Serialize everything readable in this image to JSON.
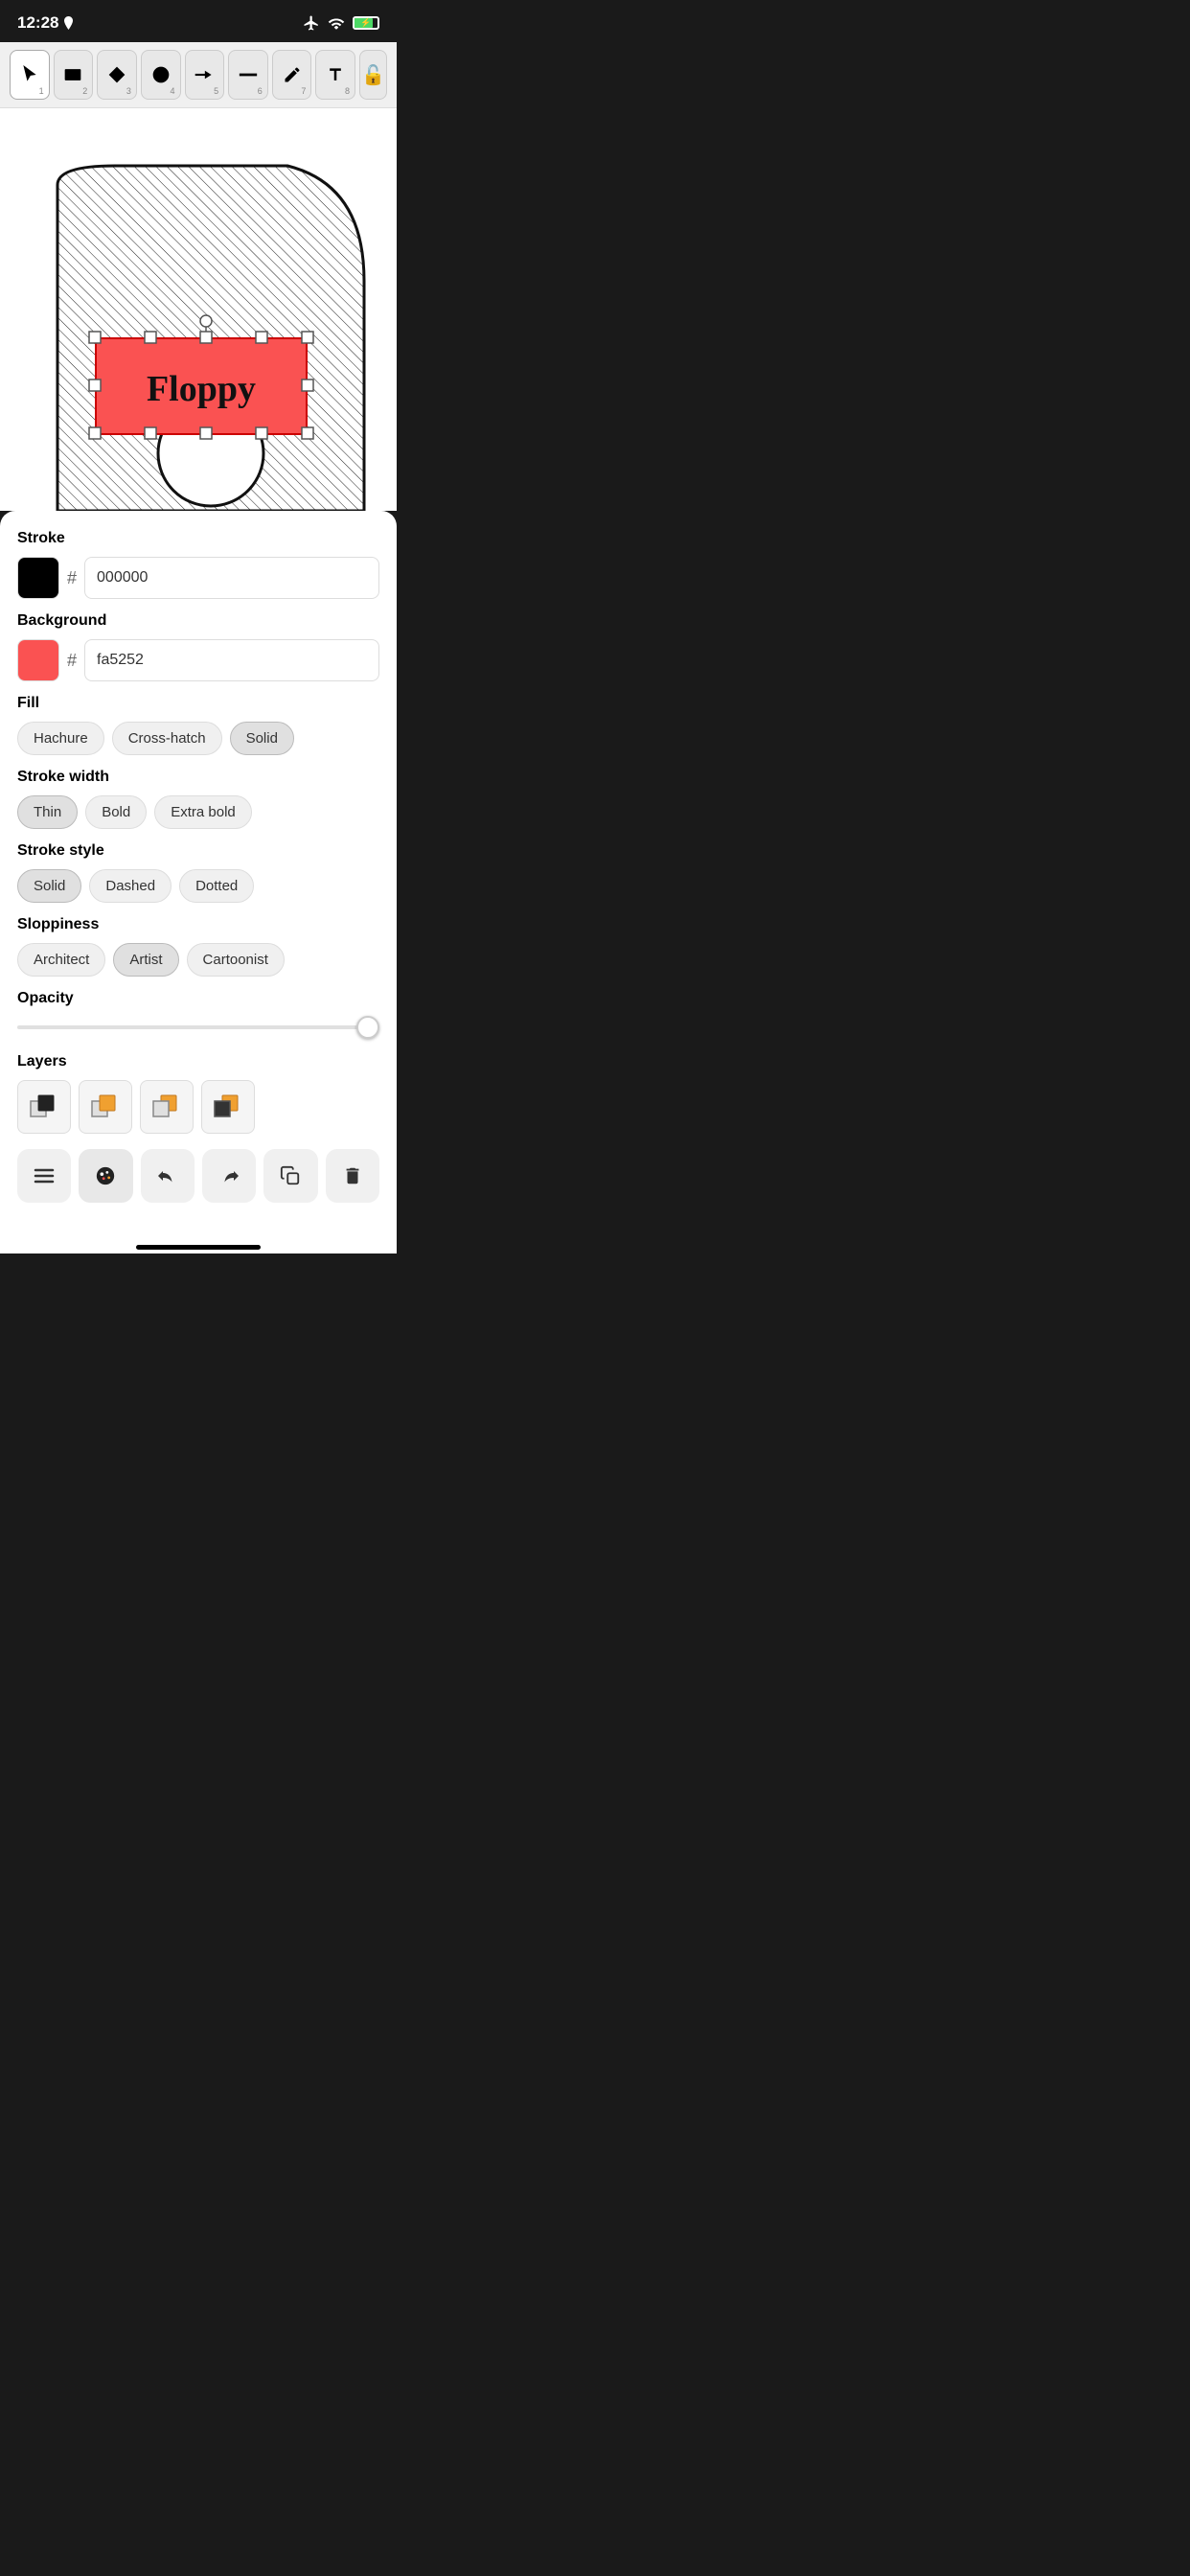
{
  "status": {
    "time": "12:28",
    "location_arrow": true
  },
  "toolbar": {
    "tools": [
      {
        "id": "select",
        "num": "1",
        "symbol": "cursor",
        "active": true
      },
      {
        "id": "rectangle",
        "num": "2",
        "symbol": "rect"
      },
      {
        "id": "diamond",
        "num": "3",
        "symbol": "diamond"
      },
      {
        "id": "circle",
        "num": "4",
        "symbol": "circle"
      },
      {
        "id": "arrow",
        "num": "5",
        "symbol": "arrow"
      },
      {
        "id": "line",
        "num": "6",
        "symbol": "line"
      },
      {
        "id": "pencil",
        "num": "7",
        "symbol": "pencil"
      },
      {
        "id": "text",
        "num": "8",
        "symbol": "text"
      }
    ],
    "lock": "🔓"
  },
  "panel": {
    "stroke": {
      "label": "Stroke",
      "color_hex": "000000",
      "color_value": "#000000"
    },
    "background": {
      "label": "Background",
      "color_hex": "fa5252",
      "color_value": "#fa5252"
    },
    "fill": {
      "label": "Fill",
      "options": [
        "Hachure",
        "Cross-hatch",
        "Solid"
      ],
      "active": "Solid"
    },
    "stroke_width": {
      "label": "Stroke width",
      "options": [
        "Thin",
        "Bold",
        "Extra bold"
      ],
      "active": "Thin"
    },
    "stroke_style": {
      "label": "Stroke style",
      "options": [
        "Solid",
        "Dashed",
        "Dotted"
      ],
      "active": "Solid"
    },
    "sloppiness": {
      "label": "Sloppiness",
      "options": [
        "Architect",
        "Artist",
        "Cartoonist"
      ],
      "active": "Artist"
    },
    "opacity": {
      "label": "Opacity",
      "value": 100
    },
    "layers": {
      "label": "Layers",
      "items": [
        {
          "symbol": "bring-to-front"
        },
        {
          "symbol": "bring-forward"
        },
        {
          "symbol": "send-backward"
        },
        {
          "symbol": "send-to-back"
        }
      ]
    },
    "actions": [
      {
        "id": "menu",
        "symbol": "☰"
      },
      {
        "id": "style",
        "symbol": "🎨",
        "active": true
      },
      {
        "id": "undo",
        "symbol": "↩"
      },
      {
        "id": "redo",
        "symbol": "↪"
      },
      {
        "id": "copy",
        "symbol": "⧉"
      },
      {
        "id": "delete",
        "symbol": "🗑"
      }
    ]
  },
  "canvas": {
    "shape_text": "Floppy"
  }
}
